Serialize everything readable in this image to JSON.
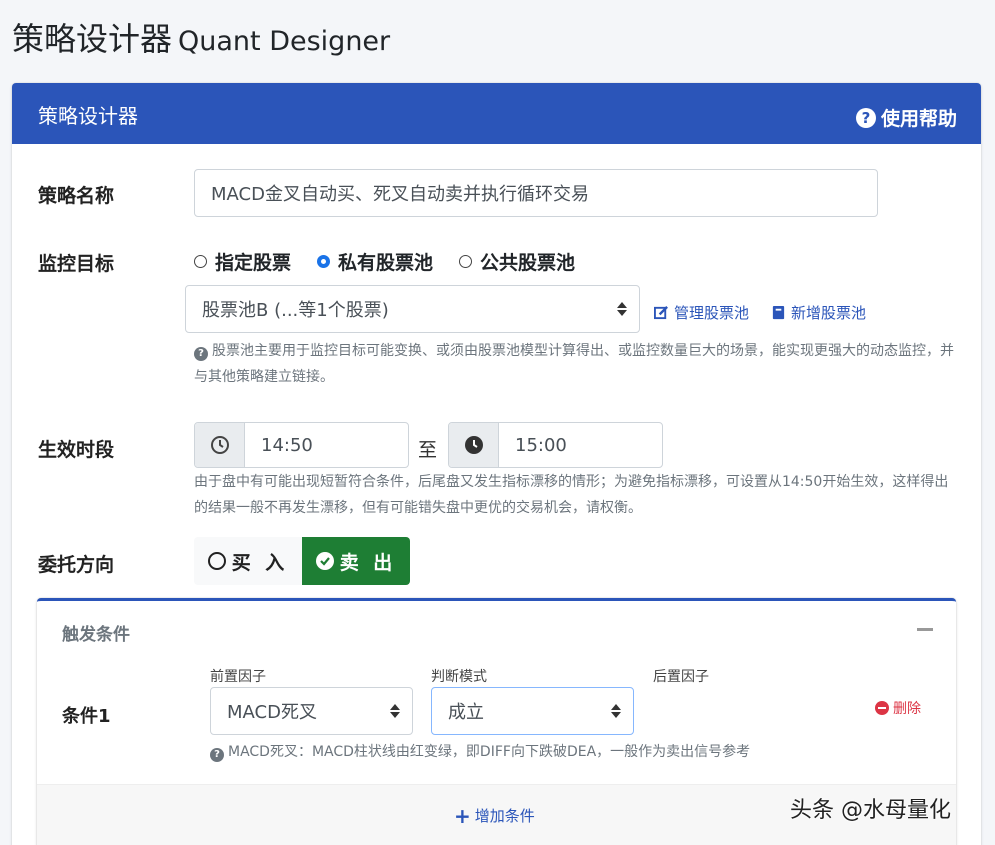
{
  "page": {
    "title_cn": "策略设计器",
    "title_en": "Quant Designer"
  },
  "card": {
    "title": "策略设计器",
    "help_label": "使用帮助"
  },
  "strategy_name": {
    "label": "策略名称",
    "value": "MACD金叉自动买、死叉自动卖并执行循环交易"
  },
  "monitor_target": {
    "label": "监控目标",
    "options": [
      "指定股票",
      "私有股票池",
      "公共股票池"
    ],
    "selected": "私有股票池",
    "pool_select": "股票池B (...等1个股票)",
    "manage_link": "管理股票池",
    "new_link": "新增股票池",
    "help": "股票池主要用于监控目标可能变换、或须由股票池模型计算得出、或监控数量巨大的场景，能实现更强大的动态监控，并与其他策略建立链接。"
  },
  "effective_period": {
    "label": "生效时段",
    "start": "14:50",
    "to": "至",
    "end": "15:00",
    "help": "由于盘中有可能出现短暂符合条件，后尾盘又发生指标漂移的情形；为避免指标漂移，可设置从14:50开始生效，这样得出的结果一般不再发生漂移，但有可能错失盘中更优的交易机会，请权衡。"
  },
  "direction": {
    "label": "委托方向",
    "buy": "买 入",
    "sell": "卖 出",
    "selected": "卖 出"
  },
  "trigger": {
    "title": "触发条件",
    "condition_label": "条件1",
    "pre_factor_label": "前置因子",
    "mode_label": "判断模式",
    "post_factor_label": "后置因子",
    "pre_factor": "MACD死叉",
    "mode": "成立",
    "delete": "删除",
    "help": "MACD死叉：MACD柱状线由红变绿，即DIFF向下跌破DEA，一般作为卖出信号参考",
    "add": "增加条件"
  },
  "watermark": "头条 @水母量化",
  "colors": {
    "primary": "#2b55b9",
    "success": "#1e7e34",
    "danger": "#dc3545"
  }
}
